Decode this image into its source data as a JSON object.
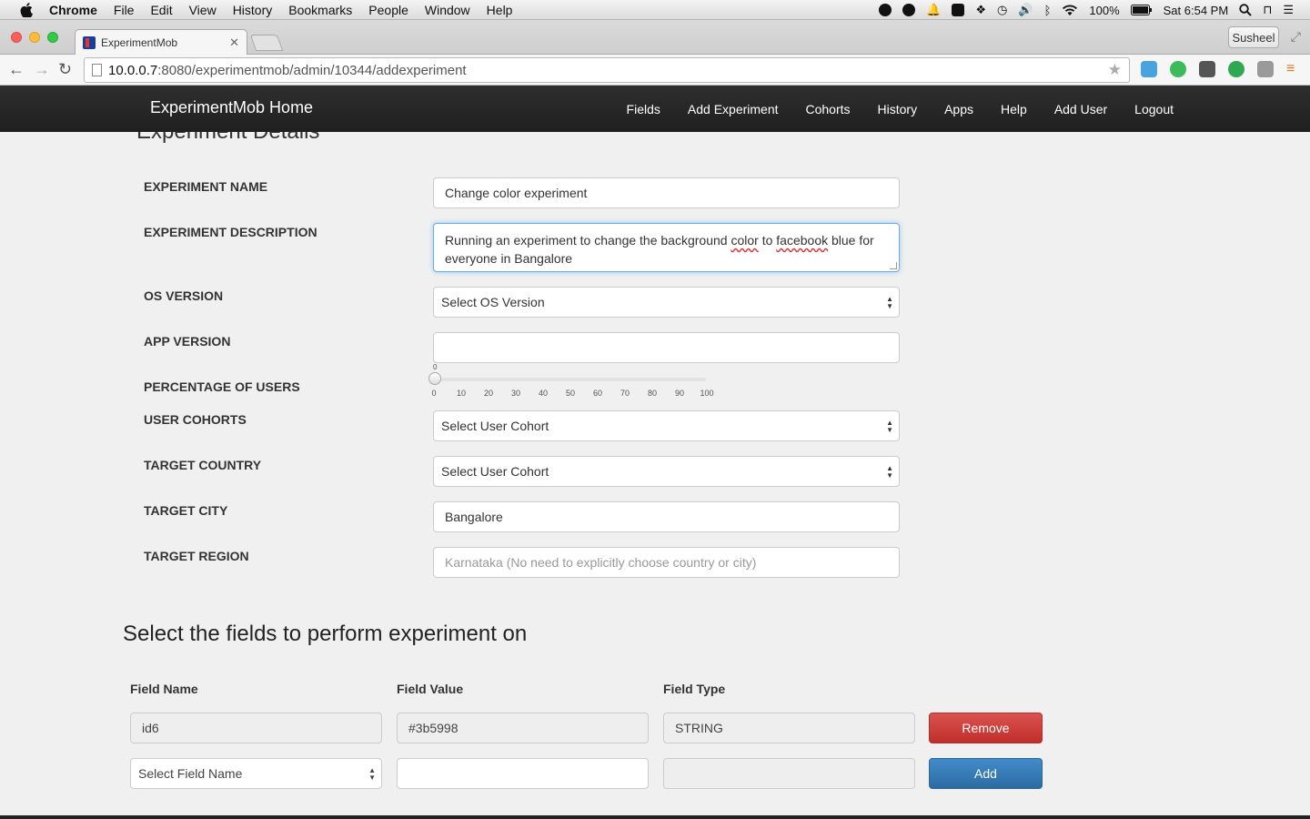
{
  "menubar": {
    "app": "Chrome",
    "items": [
      "File",
      "Edit",
      "View",
      "History",
      "Bookmarks",
      "People",
      "Window",
      "Help"
    ],
    "battery": "100%",
    "clock": "Sat 6:54 PM"
  },
  "browser": {
    "tab_title": "ExperimentMob",
    "profile": "Susheel",
    "url_host": "10.0.0.7",
    "url_path": ":8080/experimentmob/admin/10344/addexperiment"
  },
  "navbar": {
    "brand": "ExperimentMob Home",
    "links": [
      "Fields",
      "Add Experiment",
      "Cohorts",
      "History",
      "Apps",
      "Help",
      "Add User",
      "Logout"
    ]
  },
  "form": {
    "section_title": "Experiment Details",
    "labels": {
      "name": "EXPERIMENT NAME",
      "description": "EXPERIMENT DESCRIPTION",
      "os_version": "OS VERSION",
      "app_version": "APP VERSION",
      "percentage": "PERCENTAGE OF USERS",
      "cohorts": "USER COHORTS",
      "country": "TARGET COUNTRY",
      "city": "TARGET CITY",
      "region": "TARGET REGION"
    },
    "name_value": "Change color experiment",
    "description_parts": [
      "Running an experiment to change the background ",
      "color",
      " to ",
      "facebook",
      " blue for everyone in Bangalore"
    ],
    "os_version_selected": "Select OS Version",
    "app_version_value": "",
    "percentage_value": "0",
    "slider_ticks": [
      "0",
      "10",
      "20",
      "30",
      "40",
      "50",
      "60",
      "70",
      "80",
      "90",
      "100"
    ],
    "cohort_selected": "Select User Cohort",
    "country_selected": "Select User Cohort",
    "city_value": "Bangalore",
    "region_placeholder": "Karnataka (No need to explicitly choose country or city)"
  },
  "fields": {
    "title": "Select the fields to perform experiment on",
    "headers": {
      "name": "Field Name",
      "value": "Field Value",
      "type": "Field Type"
    },
    "rows": [
      {
        "name": "id6",
        "value": "#3b5998",
        "type": "STRING",
        "action": "Remove"
      }
    ],
    "new_row": {
      "name_selected": "Select Field Name",
      "value": "",
      "type": "",
      "action": "Add"
    }
  },
  "colors": {
    "navbar": "#222222",
    "danger": "#d9534f",
    "primary": "#428bca"
  }
}
